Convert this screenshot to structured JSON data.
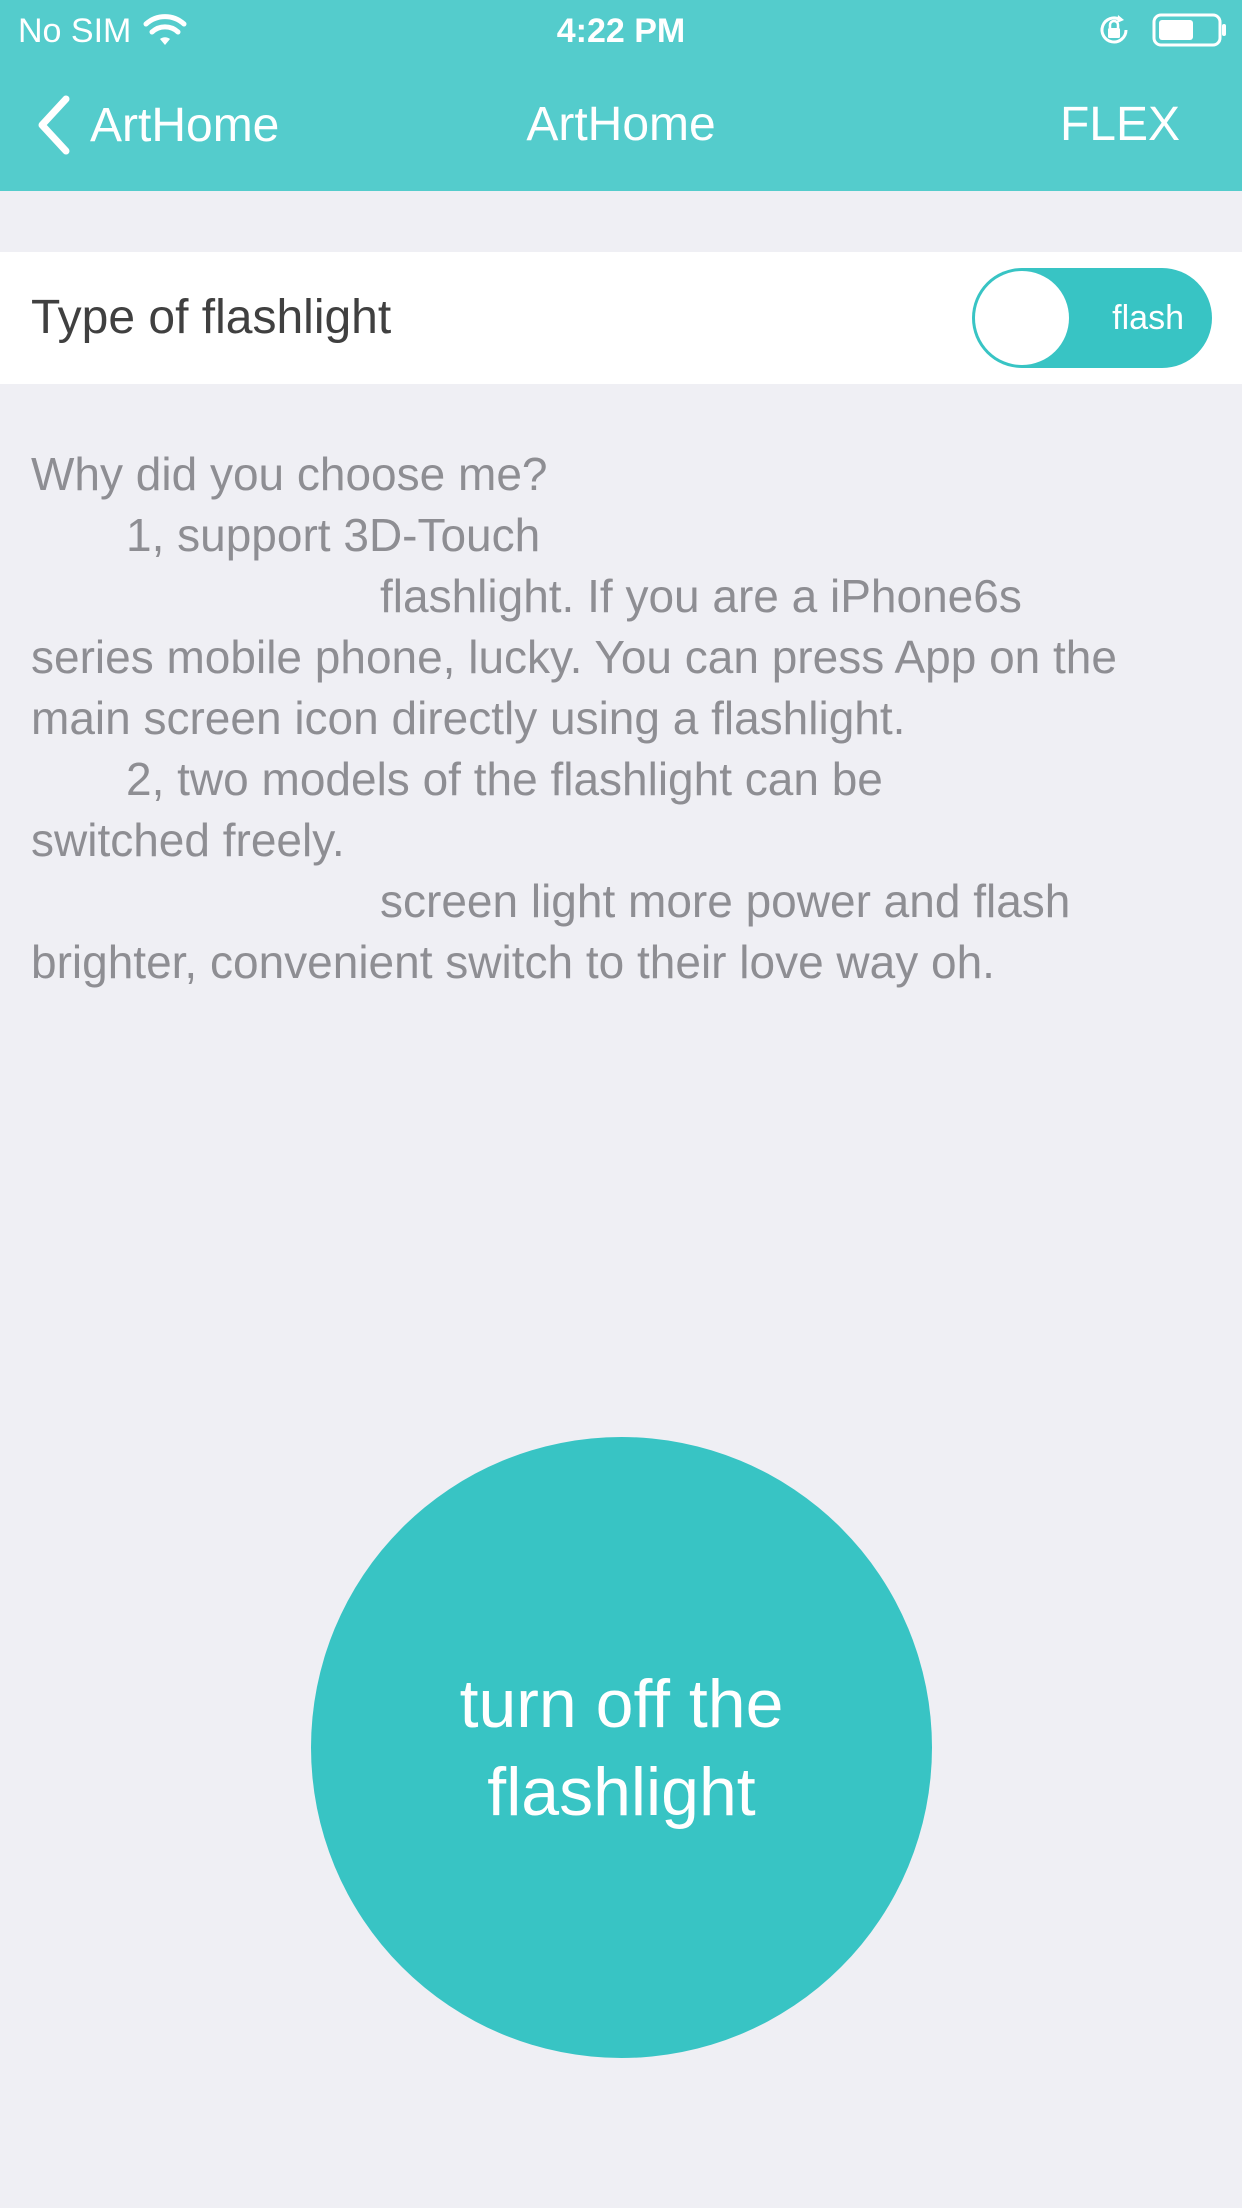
{
  "status_bar": {
    "carrier": "No SIM",
    "time": "4:22 PM",
    "icons": [
      "wifi-icon",
      "rotation-lock-icon",
      "battery-icon"
    ]
  },
  "nav": {
    "back_label": "ArtHome",
    "title": "ArtHome",
    "right_label": "FLEX",
    "icons": [
      "chevron-left-icon"
    ]
  },
  "setting": {
    "label": "Type of flashlight",
    "toggle_label": "flash",
    "toggle_on": true
  },
  "description": {
    "heading": "Why did you choose me?",
    "point1_title": "1, support 3D-Touch",
    "point1_line1": "flashlight. If you are a iPhone6s",
    "point1_rest": "series mobile phone, lucky. You can press App on the main screen icon directly using a flashlight.",
    "point2_line1": "2, two models of the flashlight can be",
    "point2_line2": "switched freely.",
    "point2_line3": "screen light more power and flash",
    "point2_rest": "brighter, convenient switch to their love way oh."
  },
  "main_button": {
    "label": "turn off the flashlight"
  },
  "colors": {
    "header": "#54cccc",
    "accent": "#38c4c4",
    "background": "#efeff4",
    "description_text": "#8e8e93"
  }
}
